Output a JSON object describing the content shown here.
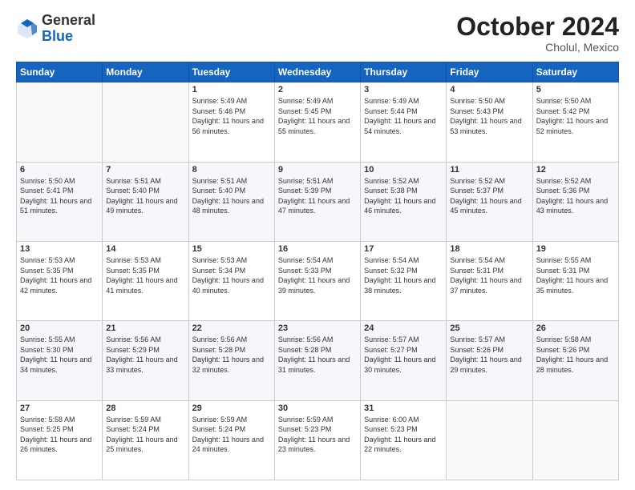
{
  "header": {
    "logo_line1": "General",
    "logo_line2": "Blue",
    "month_title": "October 2024",
    "subtitle": "Cholul, Mexico"
  },
  "weekdays": [
    "Sunday",
    "Monday",
    "Tuesday",
    "Wednesday",
    "Thursday",
    "Friday",
    "Saturday"
  ],
  "weeks": [
    [
      {
        "day": "",
        "info": ""
      },
      {
        "day": "",
        "info": ""
      },
      {
        "day": "1",
        "info": "Sunrise: 5:49 AM\nSunset: 5:46 PM\nDaylight: 11 hours and 56 minutes."
      },
      {
        "day": "2",
        "info": "Sunrise: 5:49 AM\nSunset: 5:45 PM\nDaylight: 11 hours and 55 minutes."
      },
      {
        "day": "3",
        "info": "Sunrise: 5:49 AM\nSunset: 5:44 PM\nDaylight: 11 hours and 54 minutes."
      },
      {
        "day": "4",
        "info": "Sunrise: 5:50 AM\nSunset: 5:43 PM\nDaylight: 11 hours and 53 minutes."
      },
      {
        "day": "5",
        "info": "Sunrise: 5:50 AM\nSunset: 5:42 PM\nDaylight: 11 hours and 52 minutes."
      }
    ],
    [
      {
        "day": "6",
        "info": "Sunrise: 5:50 AM\nSunset: 5:41 PM\nDaylight: 11 hours and 51 minutes."
      },
      {
        "day": "7",
        "info": "Sunrise: 5:51 AM\nSunset: 5:40 PM\nDaylight: 11 hours and 49 minutes."
      },
      {
        "day": "8",
        "info": "Sunrise: 5:51 AM\nSunset: 5:40 PM\nDaylight: 11 hours and 48 minutes."
      },
      {
        "day": "9",
        "info": "Sunrise: 5:51 AM\nSunset: 5:39 PM\nDaylight: 11 hours and 47 minutes."
      },
      {
        "day": "10",
        "info": "Sunrise: 5:52 AM\nSunset: 5:38 PM\nDaylight: 11 hours and 46 minutes."
      },
      {
        "day": "11",
        "info": "Sunrise: 5:52 AM\nSunset: 5:37 PM\nDaylight: 11 hours and 45 minutes."
      },
      {
        "day": "12",
        "info": "Sunrise: 5:52 AM\nSunset: 5:36 PM\nDaylight: 11 hours and 43 minutes."
      }
    ],
    [
      {
        "day": "13",
        "info": "Sunrise: 5:53 AM\nSunset: 5:35 PM\nDaylight: 11 hours and 42 minutes."
      },
      {
        "day": "14",
        "info": "Sunrise: 5:53 AM\nSunset: 5:35 PM\nDaylight: 11 hours and 41 minutes."
      },
      {
        "day": "15",
        "info": "Sunrise: 5:53 AM\nSunset: 5:34 PM\nDaylight: 11 hours and 40 minutes."
      },
      {
        "day": "16",
        "info": "Sunrise: 5:54 AM\nSunset: 5:33 PM\nDaylight: 11 hours and 39 minutes."
      },
      {
        "day": "17",
        "info": "Sunrise: 5:54 AM\nSunset: 5:32 PM\nDaylight: 11 hours and 38 minutes."
      },
      {
        "day": "18",
        "info": "Sunrise: 5:54 AM\nSunset: 5:31 PM\nDaylight: 11 hours and 37 minutes."
      },
      {
        "day": "19",
        "info": "Sunrise: 5:55 AM\nSunset: 5:31 PM\nDaylight: 11 hours and 35 minutes."
      }
    ],
    [
      {
        "day": "20",
        "info": "Sunrise: 5:55 AM\nSunset: 5:30 PM\nDaylight: 11 hours and 34 minutes."
      },
      {
        "day": "21",
        "info": "Sunrise: 5:56 AM\nSunset: 5:29 PM\nDaylight: 11 hours and 33 minutes."
      },
      {
        "day": "22",
        "info": "Sunrise: 5:56 AM\nSunset: 5:28 PM\nDaylight: 11 hours and 32 minutes."
      },
      {
        "day": "23",
        "info": "Sunrise: 5:56 AM\nSunset: 5:28 PM\nDaylight: 11 hours and 31 minutes."
      },
      {
        "day": "24",
        "info": "Sunrise: 5:57 AM\nSunset: 5:27 PM\nDaylight: 11 hours and 30 minutes."
      },
      {
        "day": "25",
        "info": "Sunrise: 5:57 AM\nSunset: 5:26 PM\nDaylight: 11 hours and 29 minutes."
      },
      {
        "day": "26",
        "info": "Sunrise: 5:58 AM\nSunset: 5:26 PM\nDaylight: 11 hours and 28 minutes."
      }
    ],
    [
      {
        "day": "27",
        "info": "Sunrise: 5:58 AM\nSunset: 5:25 PM\nDaylight: 11 hours and 26 minutes."
      },
      {
        "day": "28",
        "info": "Sunrise: 5:59 AM\nSunset: 5:24 PM\nDaylight: 11 hours and 25 minutes."
      },
      {
        "day": "29",
        "info": "Sunrise: 5:59 AM\nSunset: 5:24 PM\nDaylight: 11 hours and 24 minutes."
      },
      {
        "day": "30",
        "info": "Sunrise: 5:59 AM\nSunset: 5:23 PM\nDaylight: 11 hours and 23 minutes."
      },
      {
        "day": "31",
        "info": "Sunrise: 6:00 AM\nSunset: 5:23 PM\nDaylight: 11 hours and 22 minutes."
      },
      {
        "day": "",
        "info": ""
      },
      {
        "day": "",
        "info": ""
      }
    ]
  ]
}
